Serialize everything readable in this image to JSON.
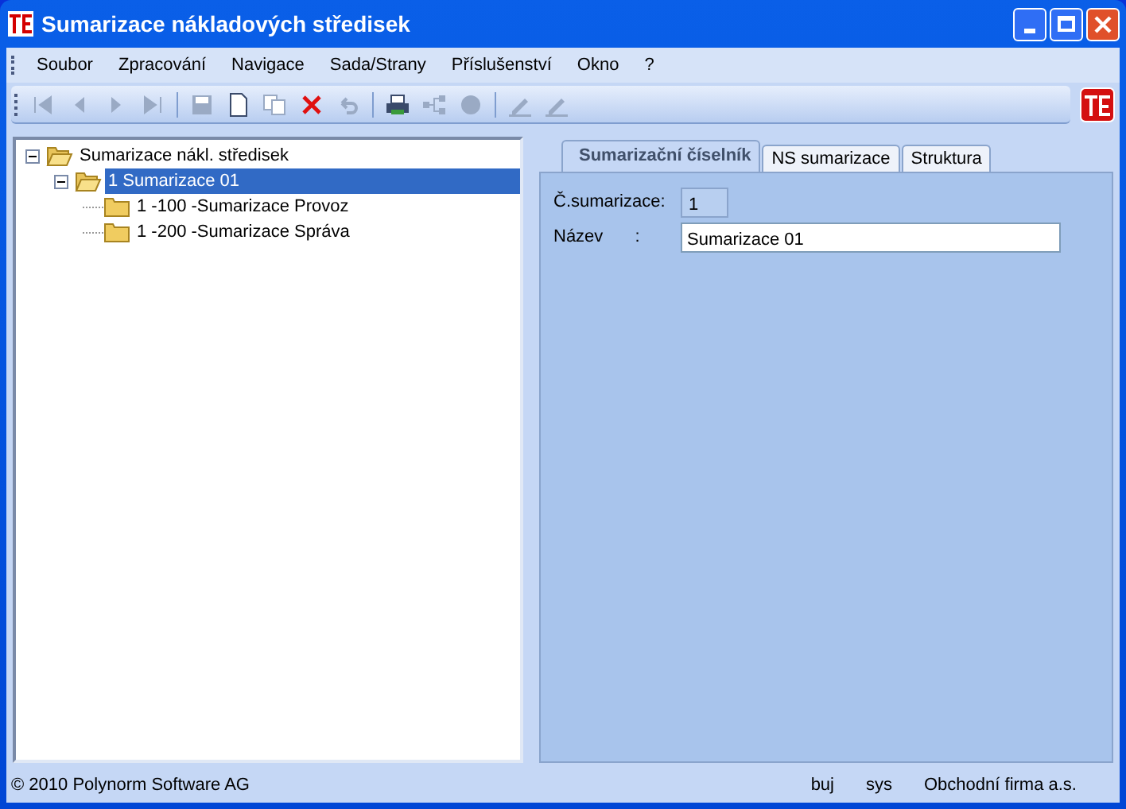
{
  "window": {
    "title": "Sumarizace nákladových středisek"
  },
  "menu": [
    "Soubor",
    "Zpracování",
    "Navigace",
    "Sada/Strany",
    "Příslušenství",
    "Okno",
    "?"
  ],
  "toolbar": [
    {
      "kind": "first",
      "disabled": true
    },
    {
      "kind": "prev",
      "disabled": true
    },
    {
      "kind": "next",
      "disabled": true
    },
    {
      "kind": "last",
      "disabled": true
    },
    {
      "kind": "sep"
    },
    {
      "kind": "save",
      "disabled": true
    },
    {
      "kind": "new",
      "disabled": false
    },
    {
      "kind": "copy",
      "disabled": true
    },
    {
      "kind": "delete",
      "disabled": false
    },
    {
      "kind": "undo",
      "disabled": true
    },
    {
      "kind": "sep"
    },
    {
      "kind": "print",
      "disabled": false
    },
    {
      "kind": "tree",
      "disabled": true
    },
    {
      "kind": "circle",
      "disabled": true
    },
    {
      "kind": "sep"
    },
    {
      "kind": "pen",
      "disabled": true
    },
    {
      "kind": "pen",
      "disabled": true
    }
  ],
  "tree": [
    {
      "label": "Sumarizace nákl. středisek",
      "expanded": true,
      "selected": false,
      "children": [
        {
          "label": "1 Sumarizace 01",
          "expanded": true,
          "selected": true,
          "children": [
            {
              "label": "1 -100 -Sumarizace Provoz",
              "selected": false
            },
            {
              "label": "1 -200 -Sumarizace Správa",
              "selected": false
            }
          ]
        }
      ]
    }
  ],
  "tabs": [
    {
      "label": "Sumarizační číselník",
      "selected": true
    },
    {
      "label": "NS sumarizace",
      "selected": false
    },
    {
      "label": "Struktura",
      "selected": false
    }
  ],
  "form": [
    {
      "label": "Č.sumarizace:",
      "value": "1",
      "kind": "readonly"
    },
    {
      "label": "Název",
      "colon": ":",
      "value": "Sumarizace 01",
      "kind": "text"
    }
  ],
  "status_bar": [
    "© 2010 Polynorm Software AG",
    "buj",
    "sys",
    "Obchodní firma a.s."
  ]
}
